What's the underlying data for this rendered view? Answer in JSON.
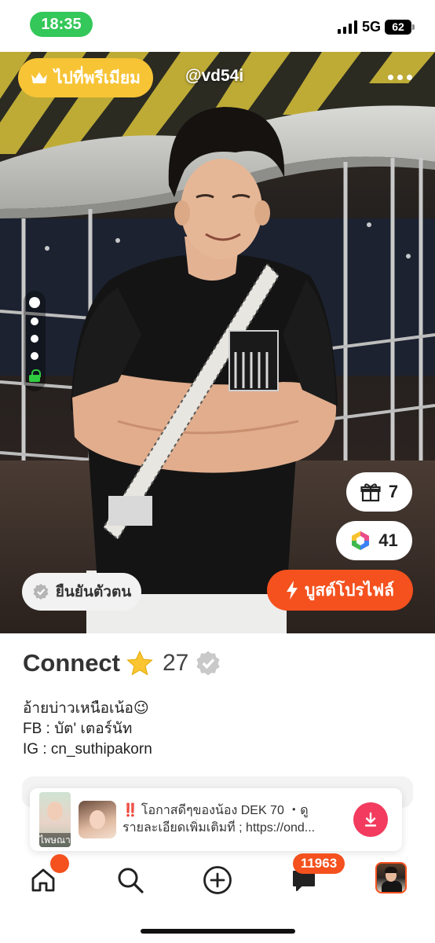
{
  "status_bar": {
    "time": "18:35",
    "network": "5G",
    "battery": "62"
  },
  "header": {
    "premium_label": "ไปที่พรีเมียม",
    "username": "@vd54i"
  },
  "photo": {
    "pages": 4,
    "active_page": 1
  },
  "stats": {
    "gifts": "7",
    "coins": "41"
  },
  "actions": {
    "verify_label": "ยืนยันตัวตน",
    "boost_label": "บูสต์โปรไฟล์"
  },
  "profile": {
    "name": "Connect",
    "age": "27",
    "bio": [
      "อ้ายบ่าวเหนือเน้อ😉",
      "FB : บัต' เตอร์นัท",
      "IG : cn_suthipakorn"
    ]
  },
  "notification": {
    "thumb_label": "ไพษณา",
    "alert": "‼️",
    "line1": "โอกาสดีๆของน้อง DEK 70 ・ดู",
    "line2": "รายละเอียดเพิ่มเติมที่ ; https://ond..."
  },
  "nav": {
    "chat_badge": "11963"
  },
  "colors": {
    "accent": "#f4511e",
    "premium": "#f7c436",
    "download": "#f23b5e",
    "status_green": "#34c759"
  }
}
